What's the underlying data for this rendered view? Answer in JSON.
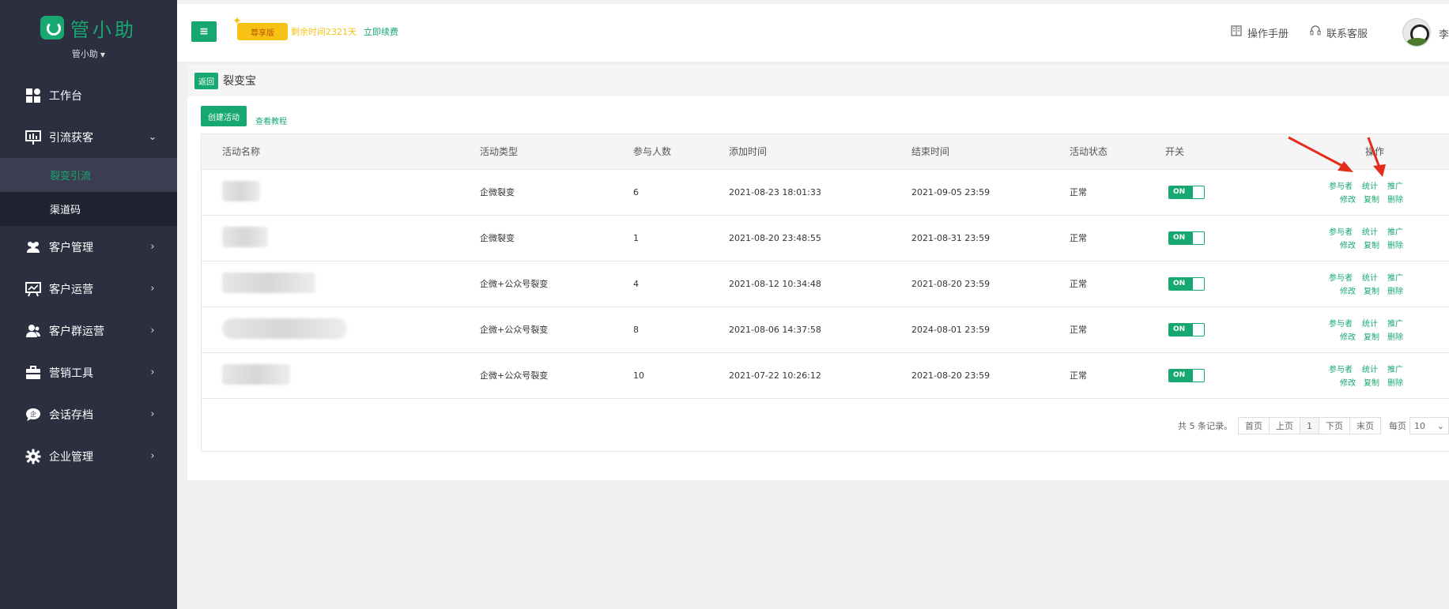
{
  "brand": {
    "name": "管小助",
    "color": "#16a870"
  },
  "user": {
    "name": "管小助",
    "short": "李"
  },
  "sidebar": {
    "items": [
      {
        "label": "工作台",
        "icon": "dashboard-icon"
      },
      {
        "label": "引流获客",
        "icon": "presentation-icon",
        "expanded": true
      },
      {
        "label": "客户管理",
        "icon": "users-icon"
      },
      {
        "label": "客户运营",
        "icon": "chart-board-icon"
      },
      {
        "label": "客户群运营",
        "icon": "group-icon"
      },
      {
        "label": "营销工具",
        "icon": "briefcase-icon"
      },
      {
        "label": "会话存档",
        "icon": "chat-archive-icon"
      },
      {
        "label": "企业管理",
        "icon": "gear-icon"
      }
    ],
    "sub_items": [
      {
        "label": "裂变引流",
        "active": true
      },
      {
        "label": "渠道码",
        "active": false
      }
    ]
  },
  "topbar": {
    "vip": "尊享版",
    "remain": "剩余时间2321天",
    "renew": "立即续费",
    "manual": "操作手册",
    "service": "联系客服"
  },
  "page": {
    "back": "返回",
    "title": "裂变宝",
    "create": "创建活动",
    "tutorial": "查看教程"
  },
  "table": {
    "headers": [
      "活动名称",
      "活动类型",
      "参与人数",
      "添加时间",
      "结束时间",
      "活动状态",
      "开关",
      "操作"
    ],
    "rows": [
      {
        "type": "企微裂变",
        "count": "6",
        "added": "2021-08-23 18:01:33",
        "end": "2021-09-05 23:59",
        "status": "正常"
      },
      {
        "type": "企微裂变",
        "count": "1",
        "added": "2021-08-20 23:48:55",
        "end": "2021-08-31 23:59",
        "status": "正常"
      },
      {
        "type": "企微+公众号裂变",
        "count": "4",
        "added": "2021-08-12 10:34:48",
        "end": "2021-08-20 23:59",
        "status": "正常"
      },
      {
        "type": "企微+公众号裂变",
        "count": "8",
        "added": "2021-08-06 14:37:58",
        "end": "2024-08-01 23:59",
        "status": "正常"
      },
      {
        "type": "企微+公众号裂变",
        "count": "10",
        "added": "2021-07-22 10:26:12",
        "end": "2021-08-20 23:59",
        "status": "正常"
      }
    ],
    "toggle_on": "ON",
    "ops": {
      "participants": "参与者",
      "stats": "统计",
      "promote": "推广",
      "edit": "修改",
      "copy": "复制",
      "delete": "删除"
    }
  },
  "pager": {
    "info": "共 5 条记录。",
    "first": "首页",
    "prev": "上页",
    "current": "1",
    "next": "下页",
    "last": "末页",
    "per_label": "每页",
    "per_value": "10"
  }
}
